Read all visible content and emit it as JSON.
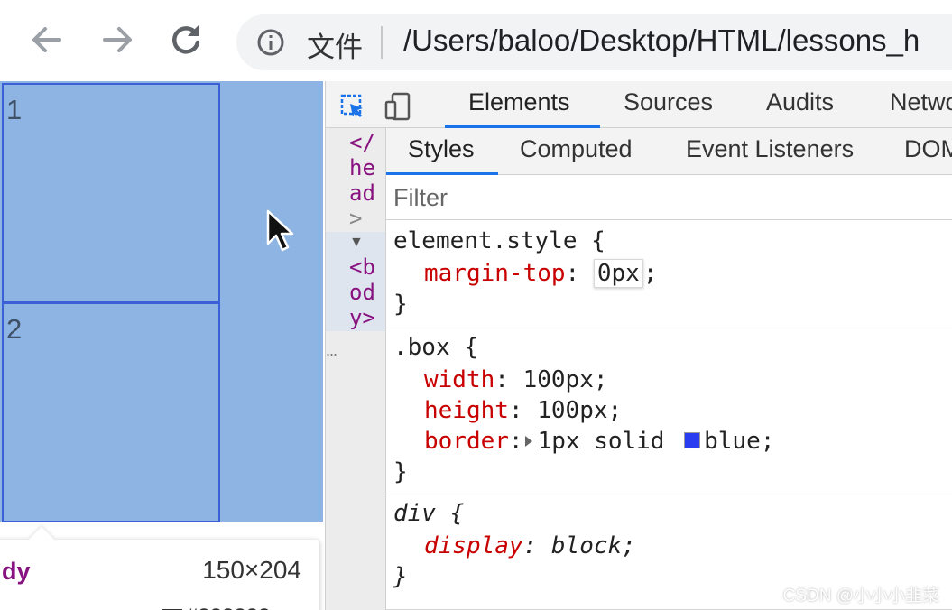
{
  "browser": {
    "omnibox": {
      "file_label": "文件",
      "url": "/Users/baloo/Desktop/HTML/lessons_h"
    }
  },
  "page": {
    "boxes": [
      {
        "label": "1"
      },
      {
        "label": "2"
      }
    ],
    "body_highlight_color": "#8db4e2",
    "box_border_color": "#3a5fd6",
    "tooltip": {
      "tag": "dy",
      "size": "150×204",
      "color_text": "#333333"
    }
  },
  "devtools": {
    "tabs": [
      "Elements",
      "Sources",
      "Audits",
      "Netwo"
    ],
    "active_tab": "Elements",
    "dom_tree": {
      "lines": [
        "</",
        "he",
        "ad",
        ">",
        "<b",
        "od",
        "y>"
      ],
      "ellipsis": "..."
    },
    "sub_tabs": [
      "Styles",
      "Computed",
      "Event Listeners",
      "DOM"
    ],
    "active_sub_tab": "Styles",
    "filter_placeholder": "Filter",
    "rules": {
      "element_style": {
        "selector": "element.style {",
        "decl": {
          "name": "margin-top",
          "value": "0px"
        },
        "close": "}"
      },
      "box": {
        "selector": ".box {",
        "decls": [
          {
            "name": "width",
            "value": "100px"
          },
          {
            "name": "height",
            "value": "100px"
          },
          {
            "name": "border",
            "value": "1px solid ",
            "color_name": "blue",
            "color_hex": "#2a3cf0"
          }
        ],
        "close": "}"
      },
      "div": {
        "selector": "div {",
        "decl": {
          "name": "display",
          "value": "block"
        },
        "close": "}"
      }
    }
  },
  "watermark": "CSDN @小小小韭菜"
}
